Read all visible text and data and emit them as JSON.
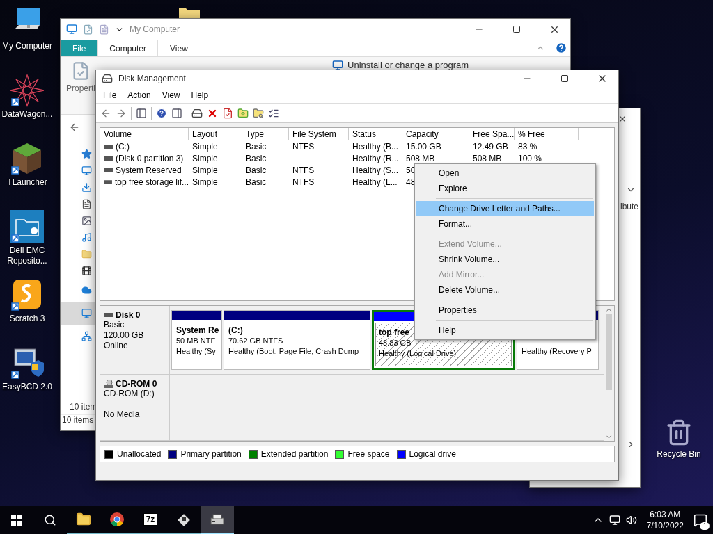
{
  "desktop_icons": [
    {
      "label": "My Computer",
      "kind": "computer"
    },
    {
      "label": "DataWagon...",
      "kind": "star"
    },
    {
      "label": "TLauncher",
      "kind": "block"
    },
    {
      "label": "Dell EMC Reposito...",
      "kind": "folder"
    },
    {
      "label": "Scratch 3",
      "kind": "scratch"
    },
    {
      "label": "EasyBCD 2.0",
      "kind": "easybcd"
    }
  ],
  "recycle_bin": {
    "label": "Recycle Bin"
  },
  "back_window": {
    "text": "ibute"
  },
  "explorer": {
    "title": "My Computer",
    "ribbon_tabs": [
      {
        "label": "File",
        "kind": "file",
        "selected": false
      },
      {
        "label": "Computer",
        "kind": "tab",
        "selected": true
      },
      {
        "label": "View",
        "kind": "tab",
        "selected": false
      }
    ],
    "ribbon_items": [
      "Properti",
      "Uninstall or change a program"
    ],
    "nav_items": [
      {
        "kind": "star",
        "selected": false
      },
      {
        "kind": "desktop",
        "selected": false
      },
      {
        "kind": "download",
        "selected": false
      },
      {
        "kind": "document",
        "selected": false
      },
      {
        "kind": "picture",
        "selected": false
      },
      {
        "kind": "music",
        "selected": false
      },
      {
        "kind": "folder",
        "selected": false
      },
      {
        "kind": "video",
        "selected": false
      },
      {
        "kind": "cloud",
        "selected": false
      },
      {
        "kind": "computer",
        "selected": true
      },
      {
        "kind": "network",
        "selected": false
      }
    ],
    "item_count": "10 item",
    "status": "10 items"
  },
  "disk_management": {
    "title": "Disk Management",
    "menu": [
      "File",
      "Action",
      "View",
      "Help"
    ],
    "table": {
      "columns": [
        "Volume",
        "Layout",
        "Type",
        "File System",
        "Status",
        "Capacity",
        "Free Spa...",
        "% Free"
      ],
      "rows": [
        {
          "cells": [
            "(C:)",
            "Simple",
            "Basic",
            "NTFS",
            "Healthy (B...",
            "15.00 GB",
            "12.49 GB",
            "83 %"
          ]
        },
        {
          "cells": [
            "(Disk 0 partition 3)",
            "Simple",
            "Basic",
            null,
            "Healthy (R...",
            "508 MB",
            "508 MB",
            "100 %"
          ]
        },
        {
          "cells": [
            "System Reserved",
            "Simple",
            "Basic",
            "NTFS",
            "Healthy (S...",
            "50"
          ]
        },
        {
          "cells": [
            "top free storage lif...",
            "Simple",
            "Basic",
            "NTFS",
            "Healthy (L...",
            "48"
          ]
        }
      ]
    },
    "disks": [
      {
        "kind": "disk",
        "name": "Disk 0",
        "lines": [
          "Basic",
          "120.00 GB",
          "Online"
        ],
        "partitions": [
          {
            "kind": "primary",
            "name": "System Re",
            "lines": [
              "50 MB NTF",
              "Healthy (Sy"
            ],
            "selected": false
          },
          {
            "kind": "primary",
            "name": "(C:)",
            "lines": [
              "70.62 GB NTFS",
              "Healthy (Boot, Page File, Crash Dump"
            ],
            "selected": false
          },
          {
            "kind": "logical",
            "name": "top free",
            "lines": [
              "48.83 GB",
              "Healthy (Logical Drive)"
            ],
            "selected": true
          },
          {
            "kind": "primary",
            "lines": [
              "Healthy (Recovery P"
            ],
            "selected": false
          }
        ]
      },
      {
        "kind": "cdrom",
        "name": "CD-ROM 0",
        "lines": [
          "CD-ROM (D:)"
        ],
        "status": "No Media"
      }
    ],
    "legend": [
      {
        "label": "Unallocated",
        "color": "#000000"
      },
      {
        "label": "Primary partition",
        "color": "#000080"
      },
      {
        "label": "Extended partition",
        "color": "#008000"
      },
      {
        "label": "Free space",
        "color": "#33ff33"
      },
      {
        "label": "Logical drive",
        "color": "#0000ff"
      }
    ]
  },
  "context_menu": [
    [
      {
        "label": "Open",
        "disabled": false,
        "selected": false
      },
      {
        "label": "Explore",
        "disabled": false,
        "selected": false
      }
    ],
    [
      {
        "label": "Change Drive Letter and Paths...",
        "disabled": false,
        "selected": true
      },
      {
        "label": "Format...",
        "disabled": false,
        "selected": false
      }
    ],
    [
      {
        "label": "Extend Volume...",
        "disabled": true,
        "selected": false
      },
      {
        "label": "Shrink Volume...",
        "disabled": false,
        "selected": false
      },
      {
        "label": "Add Mirror...",
        "disabled": true,
        "selected": false
      },
      {
        "label": "Delete Volume...",
        "disabled": false,
        "selected": false
      }
    ],
    [
      {
        "label": "Properties",
        "disabled": false,
        "selected": false
      }
    ],
    [
      {
        "label": "Help",
        "disabled": false,
        "selected": false
      }
    ]
  ],
  "taskbar": {
    "apps": [
      {
        "kind": "explorer",
        "selected": false
      },
      {
        "kind": "chrome",
        "selected": false
      },
      {
        "kind": "sevenzip",
        "text": "7z",
        "selected": false
      },
      {
        "kind": "tool",
        "selected": false
      },
      {
        "kind": "diskmgmt",
        "selected": true
      }
    ],
    "time": "6:03 AM",
    "date": "7/10/2022",
    "notifications": "1"
  }
}
